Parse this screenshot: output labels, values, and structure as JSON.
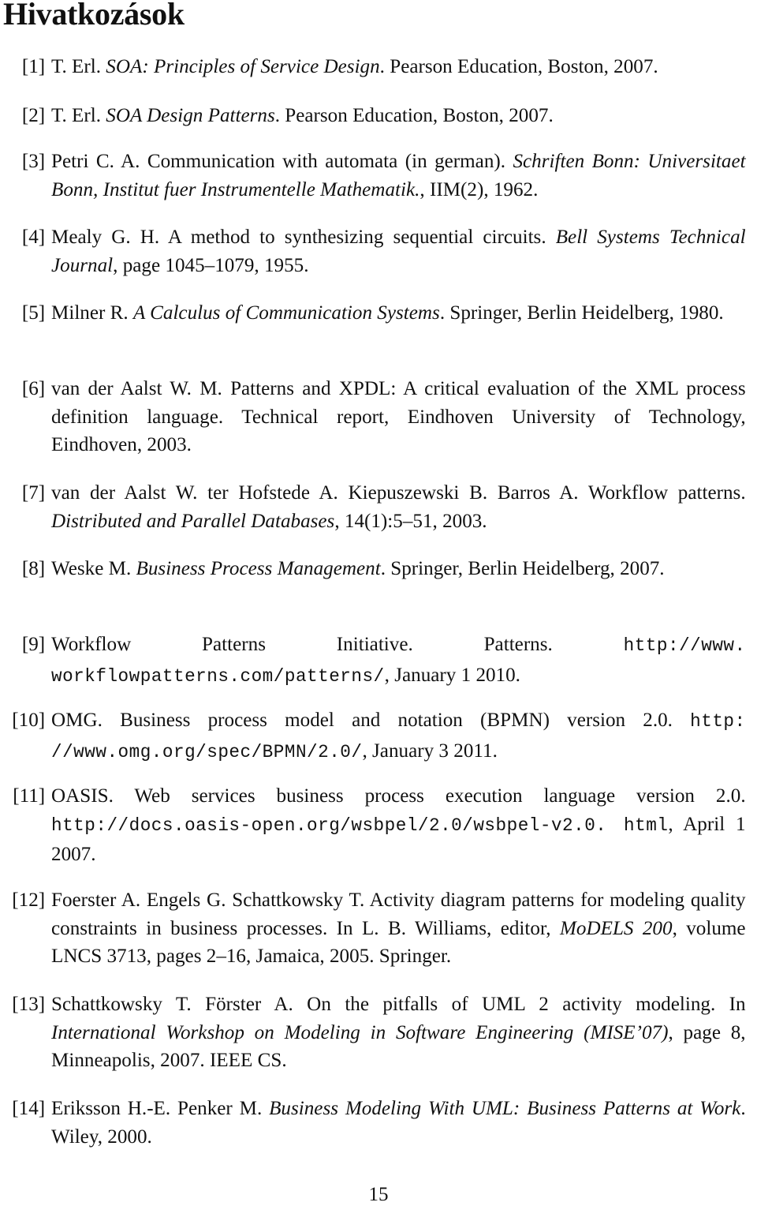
{
  "heading": "Hivatkozások",
  "page_number": "15",
  "references": [
    {
      "label": "[1]",
      "segments": [
        {
          "t": "T. Erl. ",
          "s": "n"
        },
        {
          "t": "SOA: Principles of Service Design",
          "s": "i"
        },
        {
          "t": ". Pearson Education, Boston, 2007.",
          "s": "n"
        }
      ]
    },
    {
      "label": "[2]",
      "segments": [
        {
          "t": "T. Erl. ",
          "s": "n"
        },
        {
          "t": "SOA Design Patterns",
          "s": "i"
        },
        {
          "t": ". Pearson Education, Boston, 2007.",
          "s": "n"
        }
      ]
    },
    {
      "label": "[3]",
      "segments": [
        {
          "t": "Petri C. A.  Communication with automata (in german).  ",
          "s": "n"
        },
        {
          "t": "Schriften Bonn: Universitaet Bonn, Institut fuer Instrumentelle Mathematik.",
          "s": "i"
        },
        {
          "t": ", IIM(2), 1962.",
          "s": "n"
        }
      ]
    },
    {
      "label": "[4]",
      "segments": [
        {
          "t": "Mealy G. H.  A method to synthesizing sequential circuits.  ",
          "s": "n"
        },
        {
          "t": "Bell Systems Technical Journal",
          "s": "i"
        },
        {
          "t": ", page 1045–1079, 1955.",
          "s": "n"
        }
      ]
    },
    {
      "label": "[5]",
      "segments": [
        {
          "t": "Milner R. ",
          "s": "n"
        },
        {
          "t": "A Calculus of Communication Systems",
          "s": "i"
        },
        {
          "t": ". Springer, Berlin Heidel­berg, 1980.",
          "s": "n"
        }
      ]
    },
    {
      "label": "[6]",
      "segments": [
        {
          "t": "van der Aalst W. M. Patterns and XPDL: A critical evaluation of the XML process definition language. Technical report, Eindhoven University of Tech­nology, Eindhoven, 2003.",
          "s": "n"
        }
      ]
    },
    {
      "label": "[7]",
      "segments": [
        {
          "t": "van der Aalst W. ter Hofstede A. Kiepuszewski B. Barros A.  Workflow patterns. ",
          "s": "n"
        },
        {
          "t": "Distributed and Parallel Databases",
          "s": "i"
        },
        {
          "t": ", 14(1):5–51, 2003.",
          "s": "n"
        }
      ]
    },
    {
      "label": "[8]",
      "segments": [
        {
          "t": "Weske M.  ",
          "s": "n"
        },
        {
          "t": "Business Process Management",
          "s": "i"
        },
        {
          "t": ".  Springer, Berlin Heidelberg, 2007.",
          "s": "n"
        }
      ]
    },
    {
      "label": "[9]",
      "segments": [
        {
          "t": "Workflow Patterns Initiative. Patterns. ",
          "s": "n"
        },
        {
          "t": "http://www. workflowpatterns.com/patterns/",
          "s": "m"
        },
        {
          "t": ", January 1 2010.",
          "s": "n"
        }
      ]
    },
    {
      "label": "[10]",
      "segments": [
        {
          "t": "OMG.  Business process model and notation (BPMN) version 2.0. ",
          "s": "n"
        },
        {
          "t": "http: //www.omg.org/spec/BPMN/2.0/",
          "s": "m"
        },
        {
          "t": ", January 3 2011.",
          "s": "n"
        }
      ]
    },
    {
      "label": "[11]",
      "segments": [
        {
          "t": "OASIS.  Web services business process execution language version 2.0. ",
          "s": "n"
        },
        {
          "t": "http://docs.oasis-open.org/wsbpel/2.0/wsbpel-v2.0. html",
          "s": "m"
        },
        {
          "t": ", April 1 2007.",
          "s": "n"
        }
      ]
    },
    {
      "label": "[12]",
      "segments": [
        {
          "t": "Foerster A. Engels G. Schattkowsky T.  Activity diagram patterns for mo­deling quality constraints in business processes.  In L. B. Williams, editor, ",
          "s": "n"
        },
        {
          "t": "MoDELS 200",
          "s": "i"
        },
        {
          "t": ", volume LNCS 3713, pages 2–16, Jamaica, 2005. Springer.",
          "s": "n"
        }
      ]
    },
    {
      "label": "[13]",
      "segments": [
        {
          "t": "Schattkowsky T. Förster A.  On the pitfalls of UML 2 activity modeling.  In ",
          "s": "n"
        },
        {
          "t": "International Workshop on Modeling in Software Engineering (MISE’07)",
          "s": "i"
        },
        {
          "t": ", page 8, Minneapolis, 2007. IEEE CS.",
          "s": "n"
        }
      ]
    },
    {
      "label": "[14]",
      "segments": [
        {
          "t": "Eriksson H.-E. Penker M. ",
          "s": "n"
        },
        {
          "t": "Business Modeling With UML: Business Patterns at Work",
          "s": "i"
        },
        {
          "t": ". Wiley, 2000.",
          "s": "n"
        }
      ]
    }
  ]
}
